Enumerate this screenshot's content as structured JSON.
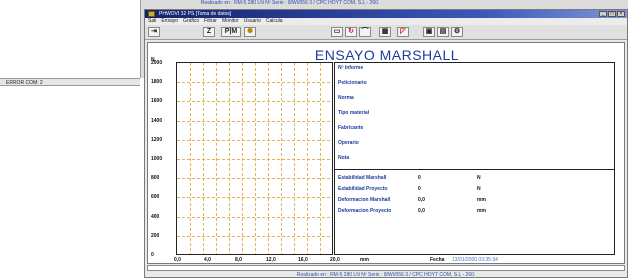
{
  "background": {
    "footer": "Realizado en : RM-5 280 LN Nº Serie : 8/WI/056 3 / CPC HOYT COM, S.L - 260.",
    "status_text": "ERROR COM: 2"
  },
  "window": {
    "title": "PHWOVI 32 PS [Toma de datos]",
    "menu": [
      "Sali",
      "Ensayo",
      "Gráfico",
      "Filtrar",
      "Monitor",
      "Usuario",
      "Calcula"
    ],
    "toolbar": {
      "z": "Z",
      "p": "P|M"
    }
  },
  "report": {
    "title": "ENSAYO MARSHALL",
    "y_unit": "N",
    "y_ticks": [
      "2000",
      "1800",
      "1600",
      "1400",
      "1200",
      "1000",
      "800",
      "600",
      "400",
      "200",
      "0"
    ],
    "x_ticks": [
      "0,0",
      "4,0",
      "8,0",
      "12,0",
      "16,0",
      "20,0"
    ],
    "x_unit": "mm",
    "fields": [
      "Nº Informe",
      "Peticionario",
      "Norma",
      "Tipo material",
      "Fabricante",
      "Operario",
      "Nota"
    ],
    "results": [
      {
        "label": "Estabilidad Marshall",
        "value": "0",
        "unit": "N"
      },
      {
        "label": "Estabilidad Proyecto",
        "value": "0",
        "unit": "N"
      },
      {
        "label": "Deformacion Marshall",
        "value": "0,0",
        "unit": "mm"
      },
      {
        "label": "Deformacion Proyecto",
        "value": "0,0",
        "unit": "mm"
      }
    ],
    "fecha_label": "Fecha",
    "fecha_value": "13/01/2000 03:35:34"
  },
  "footer": "Realizado en : RM-5 280 LN Nº Serie : 8/WI/056 3 / CPC HOYT COM, S.L - 260."
}
